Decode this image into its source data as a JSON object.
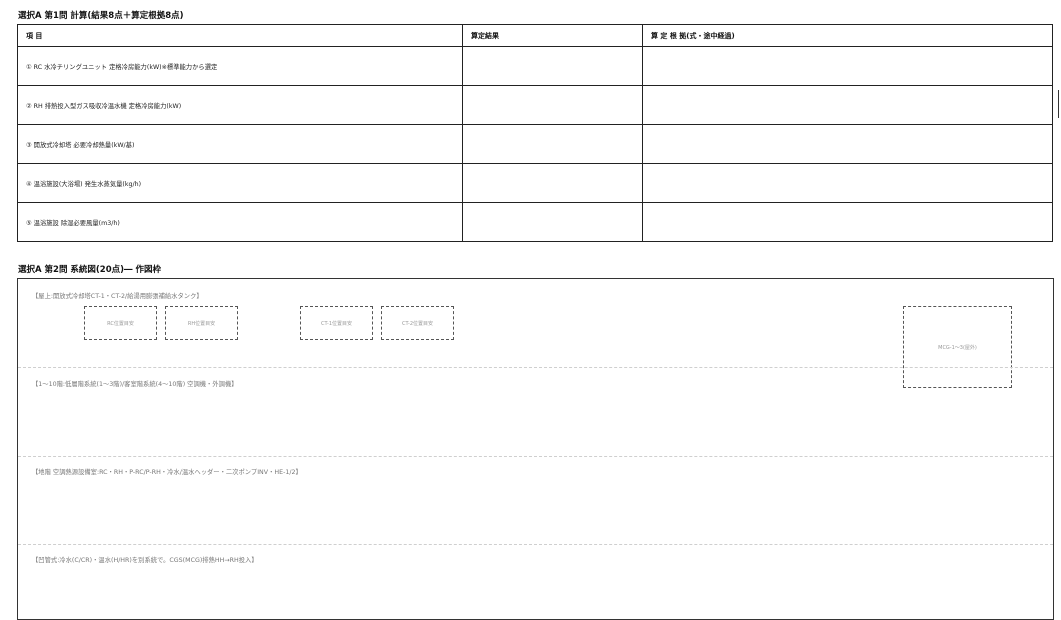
{
  "section1": {
    "title": "選択A 第1問 計算(結果8点＋算定根拠8点)",
    "headers": [
      "項 目",
      "算定結果",
      "算 定 根 拠(式・途中経過)"
    ],
    "rows": [
      "① RC 水冷チリングユニット 定格冷房能力(kW)※標準能力から選定",
      "② RH 排熱投入型ガス吸収冷温水機 定格冷房能力(kW)",
      "③ 開放式冷却塔 必要冷却熱量(kW/基)",
      "④ 温浴施設(大浴場) 発生水蒸気量(kg/h)",
      "⑤ 温浴施設 除湿必要風量(m3/h)"
    ]
  },
  "section2": {
    "title": "選択A 第2問 系統図(20点)― 作図枠",
    "zones": [
      "【屋上:開放式冷却塔CT-1・CT-2/給湯用膨張補給水タンク】",
      "【1～10階:低層階系統(1～3階)/客室階系統(4～10階) 空調機・外調機】",
      "【地階 空調熱源設備室:RC・RH・P-RC/P-RH・冷水/温水ヘッダー・二次ポンプINV・HE-1/2】",
      "【凹管式:冷水(C/CR)・温水(H/HR)を別系統で。CGS(MCG)排熱HH→RH投入】"
    ],
    "boxes": {
      "rc": "RC位置目安",
      "rh": "RH位置目安",
      "ct1": "CT-1位置目安",
      "ct2": "CT-2位置目安",
      "mcg": "MCG-1～3(屋外)"
    }
  }
}
